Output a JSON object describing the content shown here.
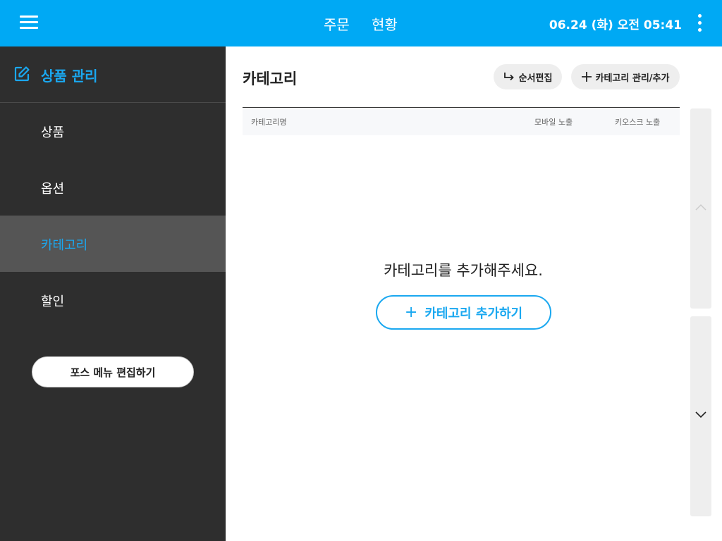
{
  "topbar": {
    "menu_icon": "hamburger-icon",
    "tabs": [
      {
        "label": "주문"
      },
      {
        "label": "현황"
      }
    ],
    "datetime": "06.24 (화) 오전 05:41",
    "more_icon": "more-vertical-icon"
  },
  "sidebar": {
    "header_icon": "edit-icon",
    "header_title": "상품 관리",
    "items": [
      {
        "label": "상품",
        "active": false
      },
      {
        "label": "옵션",
        "active": false
      },
      {
        "label": "카테고리",
        "active": true
      },
      {
        "label": "할인",
        "active": false
      }
    ],
    "pos_button": "포스 메뉴 편집하기"
  },
  "main": {
    "title": "카테고리",
    "order_edit_button": "순서편집",
    "manage_button": "카테고리 관리/추가",
    "table_headers": [
      "카테고리명",
      "모바일 노출",
      "키오스크 노출"
    ],
    "empty_message": "카테고리를 추가해주세요.",
    "add_button": "카테고리 추가하기",
    "add_button_icon": "+"
  },
  "colors": {
    "accent": "#00a9f4",
    "sidebar_bg": "#2e2e2e",
    "active_item_bg": "#555555"
  }
}
